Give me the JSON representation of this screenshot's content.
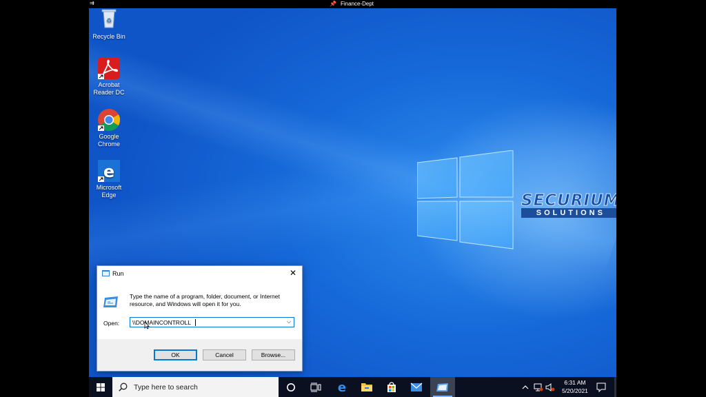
{
  "rdp": {
    "title": "Finance-Dept"
  },
  "desktop": {
    "icons": [
      {
        "label_line1": "Recycle Bin",
        "label_line2": ""
      },
      {
        "label_line1": "Acrobat",
        "label_line2": "Reader DC"
      },
      {
        "label_line1": "Google",
        "label_line2": "Chrome"
      },
      {
        "label_line1": "Microsoft",
        "label_line2": "Edge"
      }
    ],
    "watermark": {
      "big": "SECURIUM",
      "small": "SOLUTIONS"
    }
  },
  "run_dialog": {
    "title": "Run",
    "description": "Type the name of a program, folder, document, or Internet resource, and Windows will open it for you.",
    "open_label": "Open:",
    "input_value": "\\\\DOMAINCONTROLL",
    "buttons": {
      "ok": "OK",
      "cancel": "Cancel",
      "browse": "Browse..."
    }
  },
  "taskbar": {
    "search_placeholder": "Type here to search",
    "time": "6:31 AM",
    "date": "5/20/2021",
    "icons": [
      "task-view-icon",
      "edge-icon",
      "file-explorer-icon",
      "store-icon",
      "mail-icon",
      "run-icon"
    ]
  },
  "colors": {
    "desktop_blue": "#1668d8",
    "taskbar": "#0b1020",
    "accent": "#0078d7"
  }
}
